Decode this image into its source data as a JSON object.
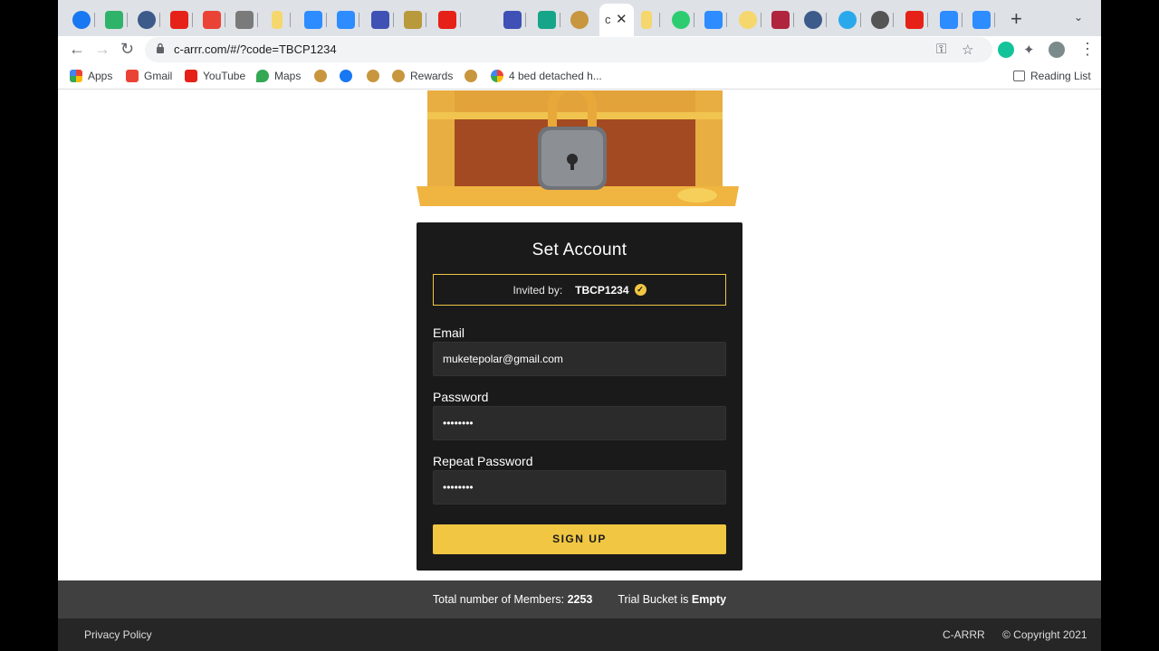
{
  "browser": {
    "active_tab_title": "c",
    "tab_close_glyph": "✕",
    "new_tab_glyph": "+",
    "url": "c-arrr.com/#/?code=TBCP1234",
    "bookmarks": [
      {
        "label": "Apps",
        "icon": "apps-grid-icon"
      },
      {
        "label": "Gmail",
        "icon": "gmail-icon"
      },
      {
        "label": "YouTube",
        "icon": "youtube-icon"
      },
      {
        "label": "Maps",
        "icon": "maps-icon"
      },
      {
        "label": "Rewards",
        "icon": "rewards-icon"
      },
      {
        "label": "4 bed detached h...",
        "icon": "google-icon"
      }
    ],
    "reading_list": "Reading List"
  },
  "form": {
    "title": "Set Account",
    "invited_label": "Invited by:",
    "invite_code": "TBCP1234",
    "email_label": "Email",
    "email_value": "muketepolar@gmail.com",
    "password_label": "Password",
    "password_value": "••••••••",
    "repeat_label": "Repeat Password",
    "repeat_value": "••••••••",
    "submit": "SIGN UP"
  },
  "stats": {
    "members_label": "Total number of Members:",
    "members_count": "2253",
    "trial_label": "Trial Bucket is",
    "trial_status": "Empty"
  },
  "footer": {
    "privacy": "Privacy Policy",
    "brand": "C-ARRR",
    "copyright": "© Copyright 2021"
  },
  "colors": {
    "accent": "#f0c642",
    "card": "#1a1a1a",
    "stats_bar": "#404040",
    "footer": "#262626"
  }
}
